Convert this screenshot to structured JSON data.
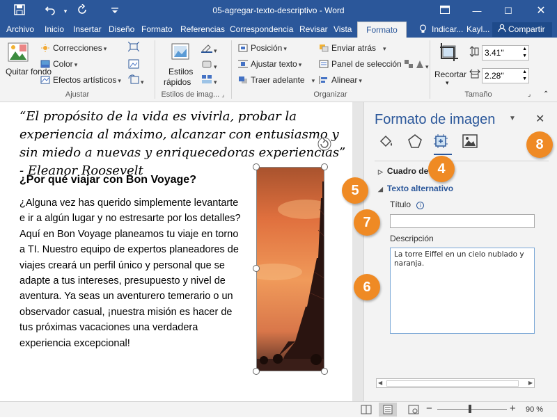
{
  "window": {
    "title": "05-agregar-texto-descriptivo - Word"
  },
  "qat": {
    "save_icon": "save-icon",
    "undo_icon": "undo-icon",
    "redo_icon": "redo-icon",
    "customize_icon": "customize-qat-icon"
  },
  "tabs": [
    "Archivo",
    "Inicio",
    "Insertar",
    "Diseño",
    "Formato",
    "Referencias",
    "Correspondencia",
    "Revisar",
    "Vista"
  ],
  "active_tab": "Formato",
  "tell_me": "Indicar...",
  "user": "Kayl...",
  "share_label": "Compartir",
  "ribbon": {
    "quitar_fondo": "Quitar fondo",
    "correcciones": "Correcciones",
    "color": "Color",
    "efectos": "Efectos artísticos",
    "ajustar_label": "Ajustar",
    "estilos_rapidos_1": "Estilos",
    "estilos_rapidos_2": "rápidos",
    "estilos_label": "Estilos de imag...",
    "posicion": "Posición",
    "ajustar_texto": "Ajustar texto",
    "traer_adelante": "Traer adelante",
    "enviar_atras": "Enviar atrás",
    "panel_seleccion": "Panel de selección",
    "alinear": "Alinear",
    "organizar_label": "Organizar",
    "recortar": "Recortar",
    "height": "3.41\"",
    "width": "2.28\"",
    "tamano_label": "Tamaño"
  },
  "document": {
    "quote": "“El propósito de la vida es vivirla, probar la experiencia al máximo, alcanzar con entusiasmo y sin miedo a nuevas y enriquecedoras experiencias” - Eleanor Roosevelt",
    "heading": "¿Por qué viajar con Bon Voyage?",
    "body": "¿Alguna vez has querido simplemente levantarte e ir a algún lugar y no estresarte por los detalles?  Aquí en Bon Voyage planeamos tu viaje en torno a TI. Nuestro equipo de expertos planeadores de viajes creará un perfil único y personal que se adapte a tus intereses, presupuesto y nivel de aventura. Ya seas un aventurero temerario o un observador casual, ¡nuestra misión es hacer de tus próximas vacaciones una verdadera experiencia excepcional!"
  },
  "pane": {
    "title": "Formato de imagen",
    "section_crop": "Cuadro de",
    "section_alt": "Texto alternativo",
    "title_label": "Título",
    "title_value": "",
    "description_label": "Descripción",
    "description_value": "La torre Eiffel en un cielo nublado y naranja."
  },
  "badges": [
    "4",
    "5",
    "6",
    "7",
    "8"
  ],
  "status": {
    "zoom": "90 %"
  },
  "colors": {
    "accent": "#2b579a",
    "badge": "#ef8a24"
  }
}
